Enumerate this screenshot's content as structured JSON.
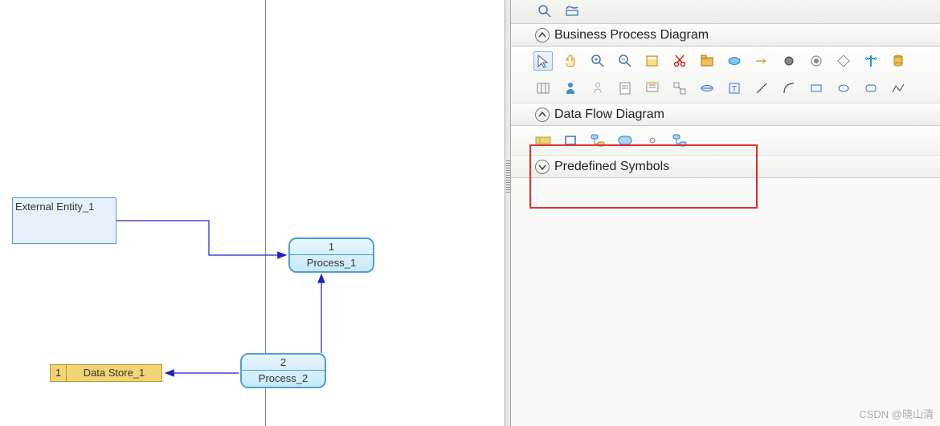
{
  "canvas": {
    "external_entity": {
      "label": "External Entity_1"
    },
    "process1": {
      "num": "1",
      "label": "Process_1"
    },
    "process2": {
      "num": "2",
      "label": "Process_2"
    },
    "datastore": {
      "num": "1",
      "label": "Data Store_1"
    }
  },
  "panels": {
    "bpd": {
      "title": "Business Process Diagram"
    },
    "dfd": {
      "title": "Data Flow Diagram"
    },
    "predefined": {
      "title": "Predefined Symbols"
    }
  },
  "watermark": "CSDN @晓山清"
}
